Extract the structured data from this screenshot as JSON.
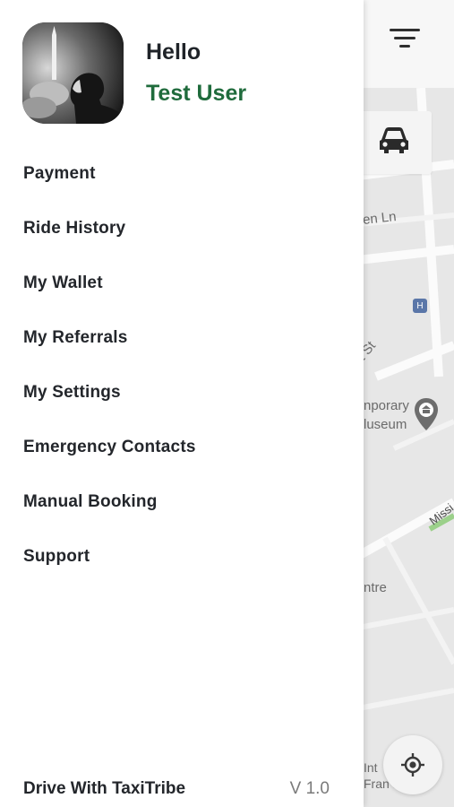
{
  "header": {
    "greeting": "Hello",
    "user_name": "Test User"
  },
  "menu": {
    "items": [
      {
        "label": "Payment"
      },
      {
        "label": "Ride History"
      },
      {
        "label": "My Wallet"
      },
      {
        "label": "My Referrals"
      },
      {
        "label": "My Settings"
      },
      {
        "label": "Emergency Contacts"
      },
      {
        "label": "Manual Booking"
      },
      {
        "label": "Support"
      }
    ]
  },
  "footer": {
    "drive_link": "Drive With TaxiTribe",
    "version": "V 1.0"
  },
  "map": {
    "labels": {
      "street_ln": "en Ln",
      "street_st": "t St",
      "museum_line1": "nporary",
      "museum_line2": "luseum",
      "mission": "Missi",
      "centre": "ntre",
      "int": "Int",
      "fra": "Fran         an"
    },
    "transit_badge": "H"
  },
  "icons": {
    "filter": "filter-icon",
    "car": "car-icon",
    "locate": "my-location-icon",
    "museum": "museum-pin-icon"
  },
  "colors": {
    "accent_green": "#1f6b3c",
    "text_dark": "#23262b",
    "version_gray": "#7a7a7a",
    "map_bg": "#e7e7e7"
  }
}
